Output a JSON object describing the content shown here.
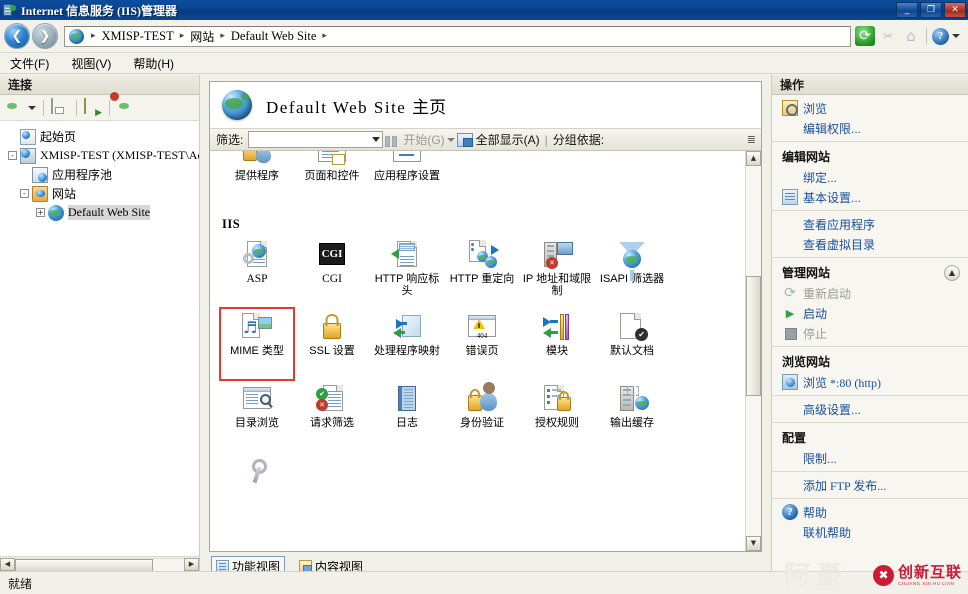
{
  "window": {
    "title": "Internet 信息服务 (IIS)管理器",
    "icon": "iis-manager-icon",
    "buttons": {
      "minimize": "_",
      "maximize": "❐",
      "close": "✕"
    }
  },
  "addressbar": {
    "back_icon": "back-arrow-icon",
    "forward_icon": "forward-arrow-icon",
    "site_icon": "globe-icon",
    "crumbs": [
      "XMISP-TEST",
      "网站",
      "Default Web Site"
    ],
    "separator": "▸",
    "tools": {
      "refresh_icon": "refresh-icon",
      "cut_icon": "scissors-icon",
      "home_icon": "home-icon",
      "help_icon": "help-icon",
      "help_caret": "▾"
    }
  },
  "menubar": {
    "items": [
      {
        "label": "文件(F)"
      },
      {
        "label": "视图(V)"
      },
      {
        "label": "帮助(H)"
      }
    ]
  },
  "left_panel": {
    "header": "连接",
    "toolbar": [
      {
        "name": "connect-to-icon",
        "caret": "▾"
      },
      {
        "name": "save-icon"
      },
      {
        "name": "start-page-icon"
      },
      {
        "name": "disconnect-icon"
      }
    ],
    "tree": [
      {
        "label": "起始页",
        "icon": "start-page-icon",
        "expander": "",
        "indent": 14,
        "mono": false,
        "selected": false
      },
      {
        "label": "XMISP-TEST (XMISP-TEST\\Adm",
        "icon": "server-icon",
        "expander": "-",
        "indent": 2,
        "mono": true,
        "selected": false
      },
      {
        "label": "应用程序池",
        "icon": "app-pool-icon",
        "expander": "",
        "indent": 26,
        "mono": false,
        "selected": false
      },
      {
        "label": "网站",
        "icon": "sites-folder-icon",
        "expander": "-",
        "indent": 14,
        "mono": false,
        "selected": false
      },
      {
        "label": "Default Web Site",
        "icon": "website-globe-icon",
        "expander": "+",
        "indent": 26,
        "mono": true,
        "selected": true
      }
    ],
    "hscroll": {
      "left": "◀",
      "right": "▶"
    }
  },
  "main": {
    "page_title_name": "Default Web Site",
    "page_title_suffix": "主页",
    "page_icon": "globe-icon",
    "filter": {
      "label": "筛选:",
      "value": "",
      "placeholder": "",
      "dropdown_caret": "▾",
      "go_label": "开始(G)",
      "go_caret": "▾",
      "show_all_label": "全部显示(A)",
      "separator": "|",
      "group_by_label": "分组依据:",
      "expander": "≣"
    },
    "groups": [
      {
        "name": "",
        "rows": [
          [
            {
              "label": "提供程序",
              "icon": "providers-icon",
              "mono": false,
              "highlighted": false
            },
            {
              "label": "页面和控件",
              "icon": "pages-and-controls-icon",
              "mono": false,
              "highlighted": false
            },
            {
              "label": "应用程序设置",
              "icon": "application-settings-icon",
              "mono": false,
              "highlighted": false
            }
          ]
        ]
      },
      {
        "name": "IIS",
        "rows": [
          [
            {
              "label": "ASP",
              "icon": "asp-icon",
              "mono": true,
              "highlighted": false
            },
            {
              "label": "CGI",
              "icon": "cgi-icon",
              "mono": true,
              "highlighted": false
            },
            {
              "label": "HTTP 响应标头",
              "icon": "http-response-headers-icon",
              "mono": false,
              "highlighted": false
            },
            {
              "label": "HTTP 重定向",
              "icon": "http-redirect-icon",
              "mono": false,
              "highlighted": false
            },
            {
              "label": "IP 地址和域限制",
              "icon": "ip-address-domain-restrictions-icon",
              "mono": false,
              "highlighted": false
            },
            {
              "label": "ISAPI 筛选器",
              "icon": "isapi-filters-icon",
              "mono": false,
              "highlighted": false
            }
          ],
          [
            {
              "label": "MIME 类型",
              "icon": "mime-types-icon",
              "mono": false,
              "highlighted": true
            },
            {
              "label": "SSL 设置",
              "icon": "ssl-settings-icon",
              "mono": false,
              "highlighted": false
            },
            {
              "label": "处理程序映射",
              "icon": "handler-mappings-icon",
              "mono": false,
              "highlighted": false
            },
            {
              "label": "错误页",
              "icon": "error-pages-icon",
              "mono": false,
              "highlighted": false
            },
            {
              "label": "模块",
              "icon": "modules-icon",
              "mono": false,
              "highlighted": false
            },
            {
              "label": "默认文档",
              "icon": "default-document-icon",
              "mono": false,
              "highlighted": false
            }
          ],
          [
            {
              "label": "目录浏览",
              "icon": "directory-browsing-icon",
              "mono": false,
              "highlighted": false
            },
            {
              "label": "请求筛选",
              "icon": "request-filtering-icon",
              "mono": false,
              "highlighted": false
            },
            {
              "label": "日志",
              "icon": "logging-icon",
              "mono": false,
              "highlighted": false
            },
            {
              "label": "身份验证",
              "icon": "authentication-icon",
              "mono": false,
              "highlighted": false
            },
            {
              "label": "授权规则",
              "icon": "authorization-rules-icon",
              "mono": false,
              "highlighted": false
            },
            {
              "label": "输出缓存",
              "icon": "output-caching-icon",
              "mono": false,
              "highlighted": false
            }
          ],
          [
            {
              "label": "",
              "icon": "configuration-editor-icon",
              "mono": false,
              "highlighted": false
            }
          ]
        ]
      }
    ],
    "scrollbar": {
      "up": "▲",
      "down": "▼"
    },
    "view_tabs": [
      {
        "label": "功能视图",
        "icon": "features-view-icon",
        "active": true
      },
      {
        "label": "内容视图",
        "icon": "content-view-icon",
        "active": false
      }
    ]
  },
  "right_panel": {
    "header": "操作",
    "groups": [
      {
        "title": "",
        "collapse_icon": "",
        "rows": [
          {
            "label": "浏览",
            "icon": "browse-icon",
            "disabled": false,
            "mono": false
          },
          {
            "label": "编辑权限...",
            "icon": "",
            "disabled": false,
            "mono": false
          }
        ]
      },
      {
        "title": "编辑网站",
        "collapse_icon": "",
        "rows": [
          {
            "label": "绑定...",
            "icon": "",
            "disabled": false,
            "mono": false
          },
          {
            "label": "基本设置...",
            "icon": "basic-settings-icon",
            "disabled": false,
            "mono": false
          }
        ]
      },
      {
        "title": "",
        "collapse_icon": "",
        "rows": [
          {
            "label": "查看应用程序",
            "icon": "",
            "disabled": false,
            "mono": false
          },
          {
            "label": "查看虚拟目录",
            "icon": "",
            "disabled": false,
            "mono": false
          }
        ]
      },
      {
        "title": "管理网站",
        "collapse_icon": "▲",
        "rows": [
          {
            "label": "重新启动",
            "icon": "restart-icon",
            "disabled": true,
            "mono": false
          },
          {
            "label": "启动",
            "icon": "start-icon",
            "disabled": false,
            "mono": false
          },
          {
            "label": "停止",
            "icon": "stop-icon",
            "disabled": true,
            "mono": false
          }
        ]
      },
      {
        "title": "浏览网站",
        "collapse_icon": "",
        "rows": [
          {
            "label": "浏览 *:80 (http)",
            "icon": "browse-site-icon",
            "disabled": false,
            "mono": true
          }
        ]
      },
      {
        "title": "",
        "collapse_icon": "",
        "rows": [
          {
            "label": "高级设置...",
            "icon": "",
            "disabled": false,
            "mono": false
          }
        ]
      },
      {
        "title": "配置",
        "collapse_icon": "",
        "rows": [
          {
            "label": "限制...",
            "icon": "",
            "disabled": false,
            "mono": false
          }
        ]
      },
      {
        "title": "",
        "collapse_icon": "",
        "rows": [
          {
            "label": "添加 FTP 发布...",
            "icon": "",
            "disabled": false,
            "mono": true
          }
        ]
      },
      {
        "title": "",
        "collapse_icon": "",
        "rows": [
          {
            "label": "帮助",
            "icon": "help-icon",
            "disabled": false,
            "mono": false
          },
          {
            "label": "联机帮助",
            "icon": "",
            "disabled": false,
            "mono": false
          }
        ]
      }
    ]
  },
  "statusbar": {
    "text": "就绪"
  },
  "watermark": {
    "text": "阿豪",
    "brand_main": "创新互联",
    "brand_sub": "CHUANG XIN HU LIAN",
    "brand_color": "#c8102e"
  }
}
